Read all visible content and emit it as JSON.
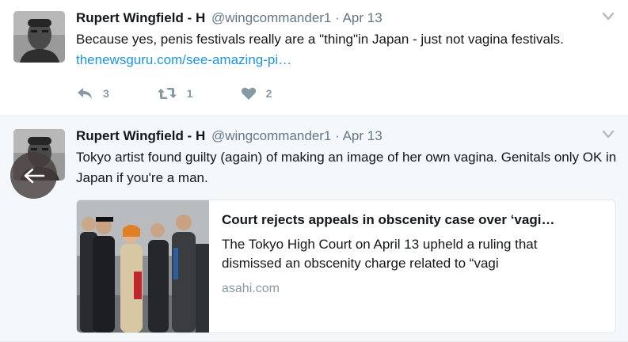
{
  "tweets": [
    {
      "fullname": "Rupert Wingfield - H",
      "username": "@wingcommander1",
      "separator": "·",
      "time": "Apr 13",
      "text": "Because yes, penis festivals really are a \"thing\"in Japan - just not vagina festivals. ",
      "link": "thenewsguru.com/see-amazing-pi…",
      "actions": {
        "reply_count": "3",
        "retweet_count": "1",
        "like_count": "2"
      }
    },
    {
      "fullname": "Rupert Wingfield - H",
      "username": "@wingcommander1",
      "separator": "·",
      "time": "Apr 13",
      "text": "Tokyo artist found guilty (again) of making an image of her own vagina. Genitals only OK in Japan if you're a man.",
      "card": {
        "title": "Court rejects appeals in obscenity case over ‘vagi…",
        "description": "The Tokyo High Court on April 13 upheld a ruling that dismissed an obscenity charge related to “vagi",
        "domain": "asahi.com"
      }
    }
  ],
  "icons": {
    "reply": "reply-icon",
    "retweet": "retweet-icon",
    "like": "heart-icon",
    "caret": "chevron-down-icon",
    "back": "arrow-left-icon"
  },
  "colors": {
    "link": "#1b95e0",
    "secondary_text": "#657786",
    "action_icon": "#8899a6",
    "hover_background": "#f5f8fa"
  }
}
